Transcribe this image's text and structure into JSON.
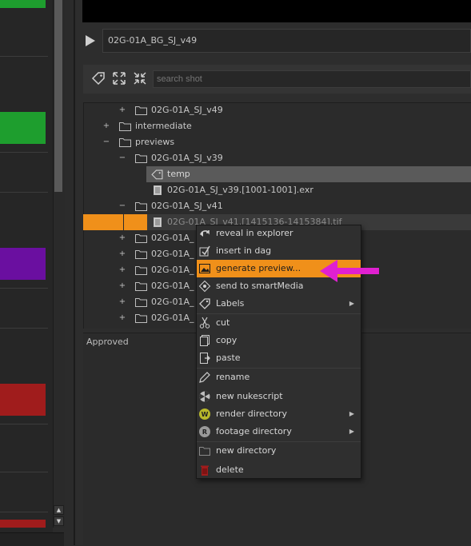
{
  "player": {
    "title": "02G-01A_BG_SJ_v49"
  },
  "search": {
    "placeholder": "search shot"
  },
  "tree": {
    "rows": [
      {
        "expander": "+",
        "label": "02G-01A_SJ_v49",
        "kind": "folder"
      },
      {
        "expander": "+",
        "label": "intermediate",
        "kind": "folder"
      },
      {
        "expander": "−",
        "label": "previews",
        "kind": "folder"
      },
      {
        "expander": "−",
        "label": "02G-01A_SJ_v39",
        "kind": "folder"
      },
      {
        "expander": "",
        "label": "temp",
        "kind": "tag"
      },
      {
        "expander": "",
        "label": "02G-01A_SJ_v39.[1001-1001].exr",
        "kind": "file"
      },
      {
        "expander": "−",
        "label": "02G-01A_SJ_v41",
        "kind": "folder"
      },
      {
        "expander": "",
        "label": "02G-01A_SJ_v41.[1415136-1415384].tif",
        "kind": "file"
      },
      {
        "expander": "+",
        "label": "02G-01A_",
        "kind": "folder"
      },
      {
        "expander": "+",
        "label": "02G-01A_",
        "kind": "folder"
      },
      {
        "expander": "+",
        "label": "02G-01A_",
        "kind": "folder"
      },
      {
        "expander": "+",
        "label": "02G-01A_",
        "kind": "folder"
      },
      {
        "expander": "+",
        "label": "02G-01A_",
        "kind": "folder"
      },
      {
        "expander": "+",
        "label": "02G-01A_",
        "kind": "folder"
      }
    ]
  },
  "status": {
    "approved": "Approved"
  },
  "menu": {
    "items": [
      {
        "label": "reveal in explorer",
        "icon": "reveal-arrow-icon"
      },
      {
        "label": "insert in dag",
        "icon": "insert-dag-icon"
      },
      {
        "label": "generate preview...",
        "icon": "image-icon",
        "highlighted": true
      },
      {
        "label": "send to smartMedia",
        "icon": "smartmedia-icon"
      },
      {
        "label": "Labels",
        "icon": "tag-icon",
        "submenu": true
      },
      {
        "label": "cut",
        "icon": "scissors-icon"
      },
      {
        "label": "copy",
        "icon": "copy-icon"
      },
      {
        "label": "paste",
        "icon": "paste-icon"
      },
      {
        "label": "rename",
        "icon": "pencil-icon"
      },
      {
        "label": "new nukescript",
        "icon": "nuke-icon"
      },
      {
        "label": "render directory",
        "icon": "render-w-icon",
        "submenu": true
      },
      {
        "label": "footage directory",
        "icon": "footage-r-icon",
        "submenu": true
      },
      {
        "label": "new directory",
        "icon": "folder-icon"
      },
      {
        "label": "delete",
        "icon": "trash-icon"
      }
    ],
    "submenu_glyph": "▶"
  },
  "colors": {
    "accent_orange": "#f0901a",
    "arrow_magenta": "#e020d0",
    "swatch_green": "#1e9e2e",
    "swatch_purple": "#6a0fa0",
    "swatch_red": "#a01c1c"
  }
}
